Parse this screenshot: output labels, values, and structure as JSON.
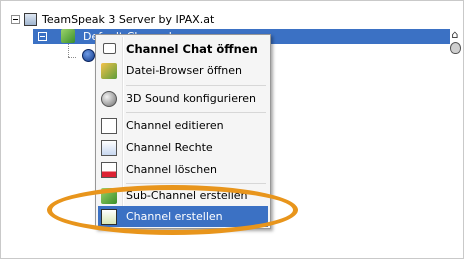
{
  "tree": {
    "server_label": "TeamSpeak 3 Server by IPAX.at",
    "channel_label": "Default Channel"
  },
  "context_menu": {
    "items": [
      {
        "label": "Channel Chat öffnen",
        "icon": "chat-icon"
      },
      {
        "label": "Datei-Browser öffnen",
        "icon": "folder-icon"
      },
      {
        "label": "3D Sound konfigurieren",
        "icon": "sphere-icon"
      },
      {
        "label": "Channel editieren",
        "icon": "edit-icon"
      },
      {
        "label": "Channel Rechte",
        "icon": "permissions-icon"
      },
      {
        "label": "Channel löschen",
        "icon": "delete-icon"
      },
      {
        "label": "Sub-Channel erstellen",
        "icon": "subchannel-icon"
      },
      {
        "label": "Channel erstellen",
        "icon": "create-channel-icon"
      }
    ]
  },
  "colors": {
    "selection": "#3b71c4",
    "annotation_ring": "#e8951c"
  }
}
